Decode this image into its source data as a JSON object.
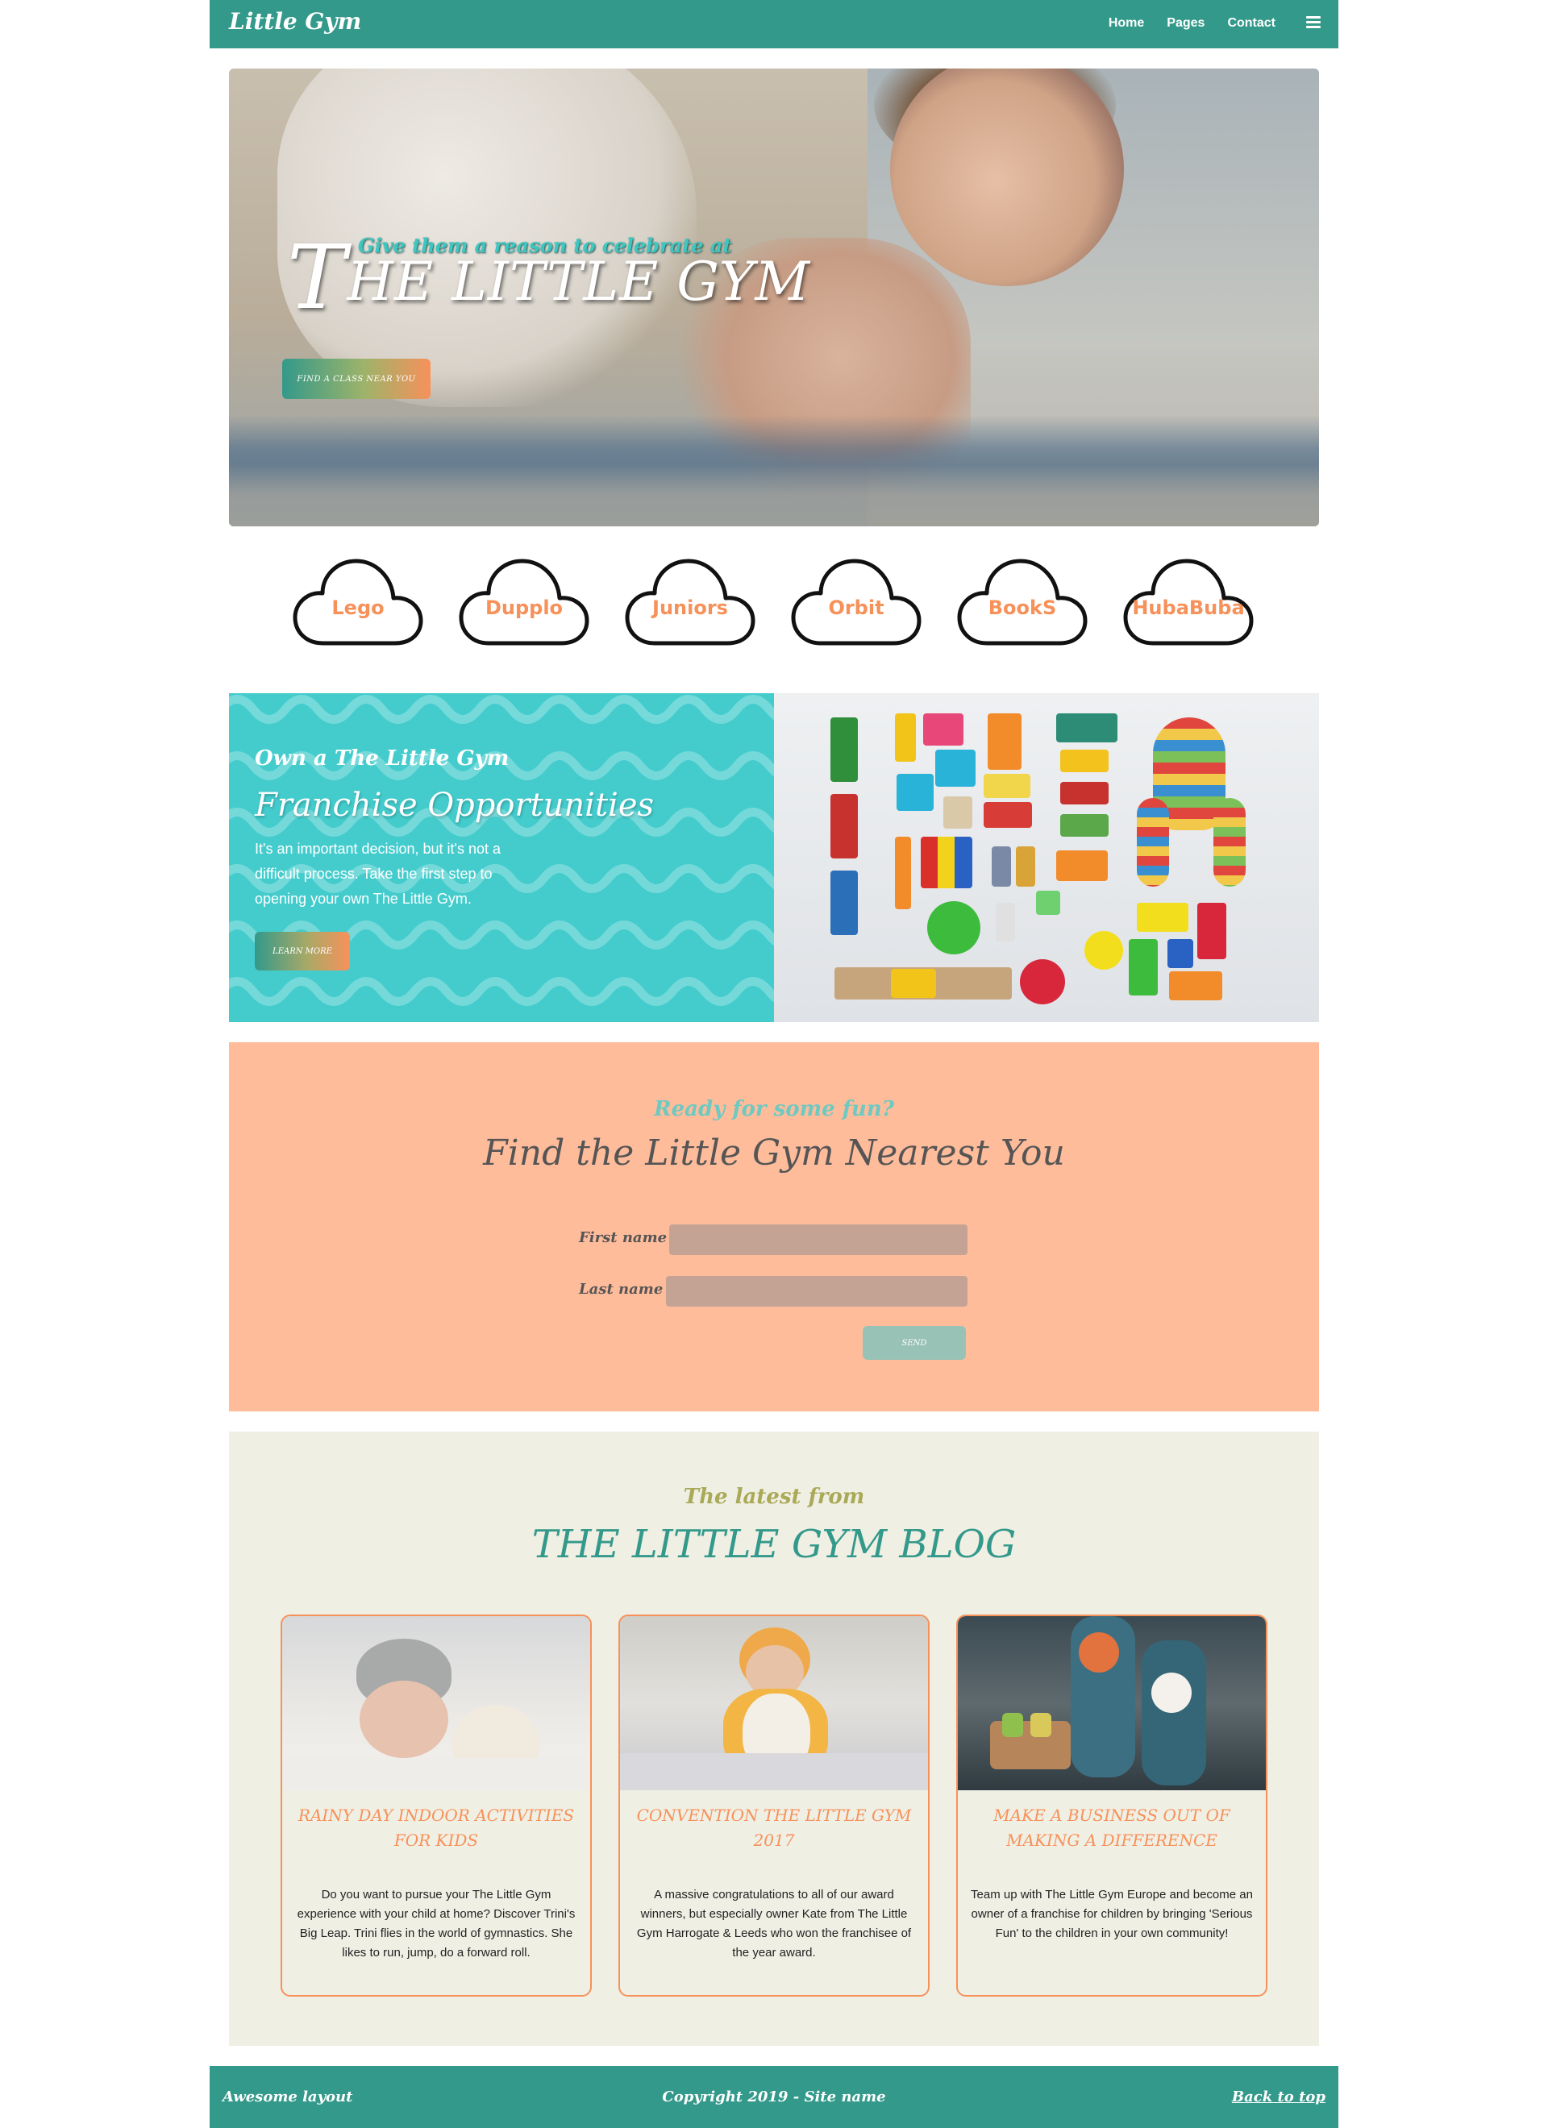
{
  "navbar": {
    "brand": "Little Gym",
    "links": [
      "Home",
      "Pages",
      "Contact"
    ],
    "menu_icon": "hamburger-icon"
  },
  "hero": {
    "subtitle": "Give them a reason to celebrate at",
    "title_initial": "T",
    "title_rest": "HE LITTLE GYM",
    "button_label": "FIND A CLASS NEAR YOU"
  },
  "categories": [
    "Lego",
    "Dupplo",
    "Juniors",
    "Orbit",
    "BookS",
    "HubaBuba"
  ],
  "franchise": {
    "kicker": "Own a The Little Gym",
    "title": "Franchise Opportunities",
    "text": "It's an important decision, but it's not a difficult process. Take the first step to opening your own The Little Gym.",
    "button_label": "LEARN MORE"
  },
  "find": {
    "kicker": "Ready for some fun?",
    "title": "Find the Little Gym Nearest You",
    "first_name_label": "First name",
    "last_name_label": "Last name",
    "first_name_value": "",
    "last_name_value": "",
    "send_label": "SEND"
  },
  "blog": {
    "kicker": "The latest from",
    "title": "THE LITTLE GYM BLOG",
    "posts": [
      {
        "title": "RAINY DAY INDOOR ACTIVITIES FOR KIDS",
        "text": "Do you want to pursue your The Little Gym experience with your child at home? Discover Trini's Big Leap. Trini flies in the world of gymnastics. She likes to run, jump, do a forward roll."
      },
      {
        "title": "CONVENTION THE LITTLE GYM 2017",
        "text": "A massive congratulations to all of our award winners, but especially owner Kate from The Little Gym Harrogate & Leeds who won the franchisee of the year award."
      },
      {
        "title": "MAKE A BUSINESS OUT OF MAKING A DIFFERENCE",
        "text": "Team up with The Little Gym Europe and become an owner of a franchise for children by bringing 'Serious Fun' to the children in your own community!"
      }
    ]
  },
  "footer": {
    "left": "Awesome layout",
    "center": "Copyright 2019 - Site name",
    "right": "Back to top"
  },
  "colors": {
    "primary": "#33998a",
    "accent": "#f7915a",
    "turquoise": "#44cccd",
    "peach": "#ffbc9b",
    "cream": "#f0efe4"
  }
}
